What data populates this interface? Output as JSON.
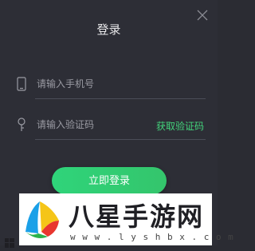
{
  "dialog": {
    "title": "登录",
    "close_icon": "close-icon"
  },
  "phone": {
    "icon": "phone-icon",
    "placeholder": "请输入手机号",
    "value": ""
  },
  "code": {
    "icon": "key-icon",
    "placeholder": "请输入验证码",
    "value": "",
    "get_code_label": "获取验证码"
  },
  "login_button": {
    "label": "立即登录"
  },
  "watermark": {
    "logo_icon": "site-logo-icon",
    "title": "八星手游网",
    "url": "w w w . l y s h b x . c o m"
  },
  "colors": {
    "background": "#2d2e36",
    "accent": "#43d37b",
    "button": "#2fd47a",
    "text": "#e8e8ea",
    "placeholder": "#9a9ba3"
  }
}
